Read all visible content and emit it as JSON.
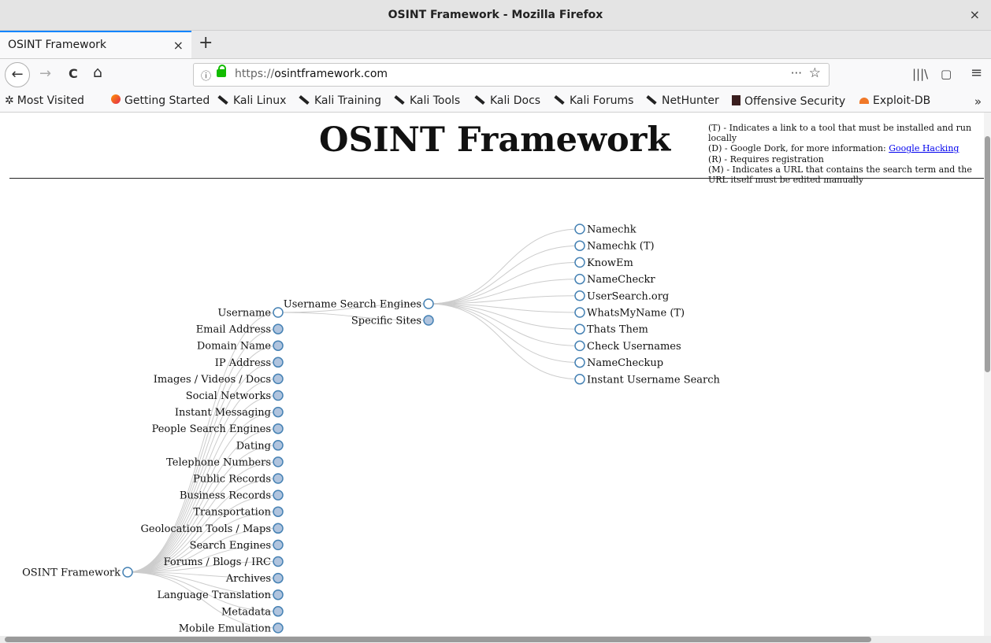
{
  "window": {
    "title": "OSINT Framework - Mozilla Firefox",
    "close_glyph": "×"
  },
  "tabs": [
    {
      "label": "OSINT Framework",
      "close_glyph": "×"
    }
  ],
  "newtab_glyph": "+",
  "nav": {
    "back_glyph": "←",
    "forward_glyph": "→",
    "reload_glyph": "C",
    "home_glyph": "⌂",
    "url_protocol": "https://",
    "url_host": "osintframework.com",
    "page_actions_glyph": "···",
    "bookmark_glyph": "☆",
    "library_glyph": "|||\\",
    "sidebar_glyph": "▢",
    "menu_glyph": "≡"
  },
  "bookmarks": [
    {
      "label": "Most Visited",
      "icon": "gear-icon"
    },
    {
      "label": "Getting Started",
      "icon": "firefox-icon"
    },
    {
      "label": "Kali Linux",
      "icon": "kali-icon"
    },
    {
      "label": "Kali Training",
      "icon": "kali-icon"
    },
    {
      "label": "Kali Tools",
      "icon": "kali-icon"
    },
    {
      "label": "Kali Docs",
      "icon": "kali-icon"
    },
    {
      "label": "Kali Forums",
      "icon": "kali-icon"
    },
    {
      "label": "NetHunter",
      "icon": "kali-icon"
    },
    {
      "label": "Offensive Security",
      "icon": "offsec-icon"
    },
    {
      "label": "Exploit-DB",
      "icon": "exploit-db-icon"
    }
  ],
  "bookmarks_more_glyph": "»",
  "page": {
    "heading": "OSINT Framework",
    "legend": {
      "t": "(T) - Indicates a link to a tool that must be installed and run locally",
      "d_prefix": "(D) - Google Dork, for more information: ",
      "d_link": "Google Hacking",
      "r": "(R) - Requires registration",
      "m": "(M) - Indicates a URL that contains the search term and the URL itself must be edited manually"
    }
  },
  "tree": {
    "root": "OSINT Framework",
    "categories": [
      {
        "label": "Username",
        "expanded": true
      },
      {
        "label": "Email Address"
      },
      {
        "label": "Domain Name"
      },
      {
        "label": "IP Address"
      },
      {
        "label": "Images / Videos / Docs"
      },
      {
        "label": "Social Networks"
      },
      {
        "label": "Instant Messaging"
      },
      {
        "label": "People Search Engines"
      },
      {
        "label": "Dating"
      },
      {
        "label": "Telephone Numbers"
      },
      {
        "label": "Public Records"
      },
      {
        "label": "Business Records"
      },
      {
        "label": "Transportation"
      },
      {
        "label": "Geolocation Tools / Maps"
      },
      {
        "label": "Search Engines"
      },
      {
        "label": "Forums / Blogs / IRC"
      },
      {
        "label": "Archives"
      },
      {
        "label": "Language Translation"
      },
      {
        "label": "Metadata"
      },
      {
        "label": "Mobile Emulation"
      }
    ],
    "username_children": [
      {
        "label": "Username Search Engines",
        "expanded": true
      },
      {
        "label": "Specific Sites"
      }
    ],
    "search_engine_children": [
      "Namechk",
      "Namechk (T)",
      "KnowEm",
      "NameCheckr",
      "UserSearch.org",
      "WhatsMyName (T)",
      "Thats Them",
      "Check Usernames",
      "NameCheckup",
      "Instant Username Search"
    ],
    "colors": {
      "open_fill": "#ffffff",
      "closed_fill": "#b0c4de",
      "stroke": "#4682b4",
      "link": "#cccccc"
    }
  }
}
